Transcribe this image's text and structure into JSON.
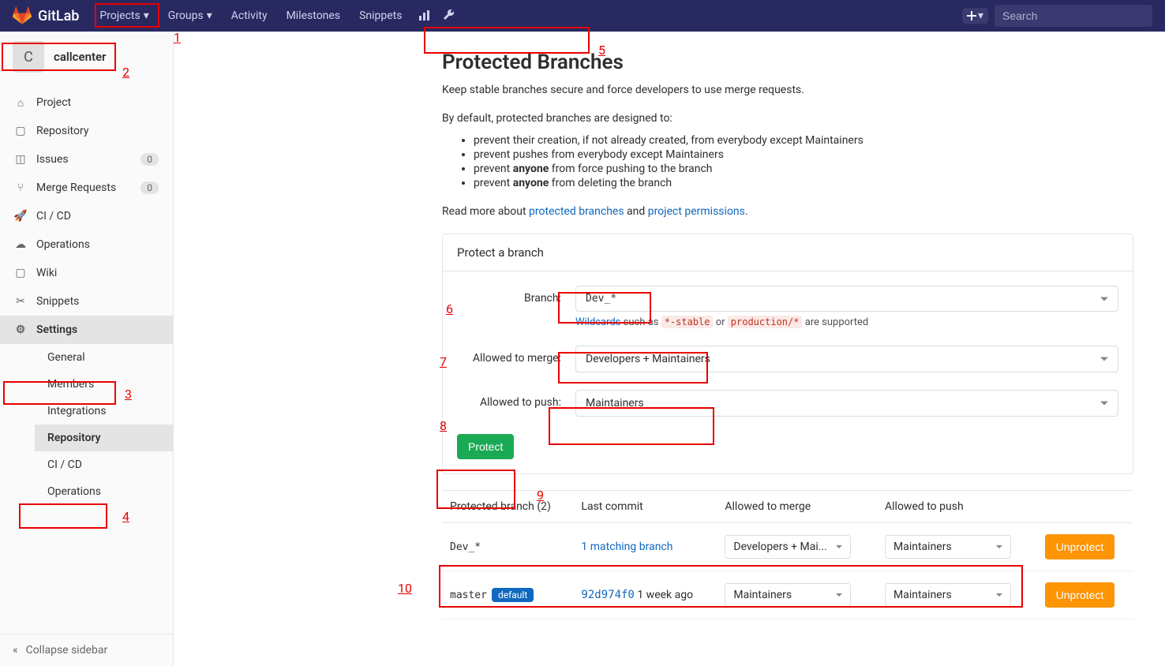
{
  "topbar": {
    "brand": "GitLab",
    "nav": [
      {
        "label": "Projects",
        "dropdown": true
      },
      {
        "label": "Groups",
        "dropdown": true
      },
      {
        "label": "Activity",
        "dropdown": false
      },
      {
        "label": "Milestones",
        "dropdown": false
      },
      {
        "label": "Snippets",
        "dropdown": false
      }
    ],
    "search_placeholder": "Search"
  },
  "project": {
    "avatar_letter": "C",
    "name": "callcenter"
  },
  "sidebar": {
    "items": [
      {
        "icon": "home-icon",
        "label": "Project"
      },
      {
        "icon": "repo-icon",
        "label": "Repository"
      },
      {
        "icon": "issues-icon",
        "label": "Issues",
        "badge": "0"
      },
      {
        "icon": "merge-icon",
        "label": "Merge Requests",
        "badge": "0"
      },
      {
        "icon": "cicd-icon",
        "label": "CI / CD"
      },
      {
        "icon": "ops-icon",
        "label": "Operations"
      },
      {
        "icon": "wiki-icon",
        "label": "Wiki"
      },
      {
        "icon": "snip-icon",
        "label": "Snippets"
      },
      {
        "icon": "gear-icon",
        "label": "Settings",
        "active": true
      }
    ],
    "settings_sub": [
      {
        "label": "General"
      },
      {
        "label": "Members"
      },
      {
        "label": "Integrations"
      },
      {
        "label": "Repository",
        "active": true
      },
      {
        "label": "CI / CD"
      },
      {
        "label": "Operations"
      }
    ],
    "collapse": "Collapse sidebar"
  },
  "page": {
    "title": "Protected Branches",
    "desc": "Keep stable branches secure and force developers to use merge requests.",
    "design_intro": "By default, protected branches are designed to:",
    "bullets": [
      "prevent their creation, if not already created, from everybody except Maintainers",
      "prevent pushes from everybody except Maintainers",
      {
        "pre": "prevent ",
        "strong": "anyone",
        "post": " from force pushing to the branch"
      },
      {
        "pre": "prevent ",
        "strong": "anyone",
        "post": " from deleting the branch"
      }
    ],
    "read_more_pre": "Read more about ",
    "read_more_link1": "protected branches",
    "read_more_mid": " and ",
    "read_more_link2": "project permissions",
    "read_more_post": "."
  },
  "form": {
    "panel_title": "Protect a branch",
    "branch_label": "Branch:",
    "branch_value": "Dev_*",
    "wildcard_link": "Wildcards",
    "wildcard_text1": " such as ",
    "wildcard_code1": "*-stable",
    "wildcard_text2": "  or  ",
    "wildcard_code2": "production/*",
    "wildcard_text3": "  are supported",
    "merge_label": "Allowed to merge:",
    "merge_value": "Developers + Maintainers",
    "push_label": "Allowed to push:",
    "push_value": "Maintainers",
    "protect_btn": "Protect"
  },
  "table": {
    "headers": [
      "Protected branch (2)",
      "Last commit",
      "Allowed to merge",
      "Allowed to push",
      ""
    ],
    "rows": [
      {
        "branch": "Dev_*",
        "commit_link": "1 matching branch",
        "commit_hash": "",
        "commit_ago": "",
        "merge": "Developers + Mai...",
        "push": "Maintainers",
        "action": "Unprotect"
      },
      {
        "branch": "master",
        "default": "default",
        "commit_hash": "92d974f0",
        "commit_ago": "1 week ago",
        "merge": "Maintainers",
        "push": "Maintainers",
        "action": "Unprotect"
      }
    ]
  },
  "annotations": [
    "1",
    "2",
    "3",
    "4",
    "5",
    "6",
    "7",
    "8",
    "9",
    "10"
  ]
}
